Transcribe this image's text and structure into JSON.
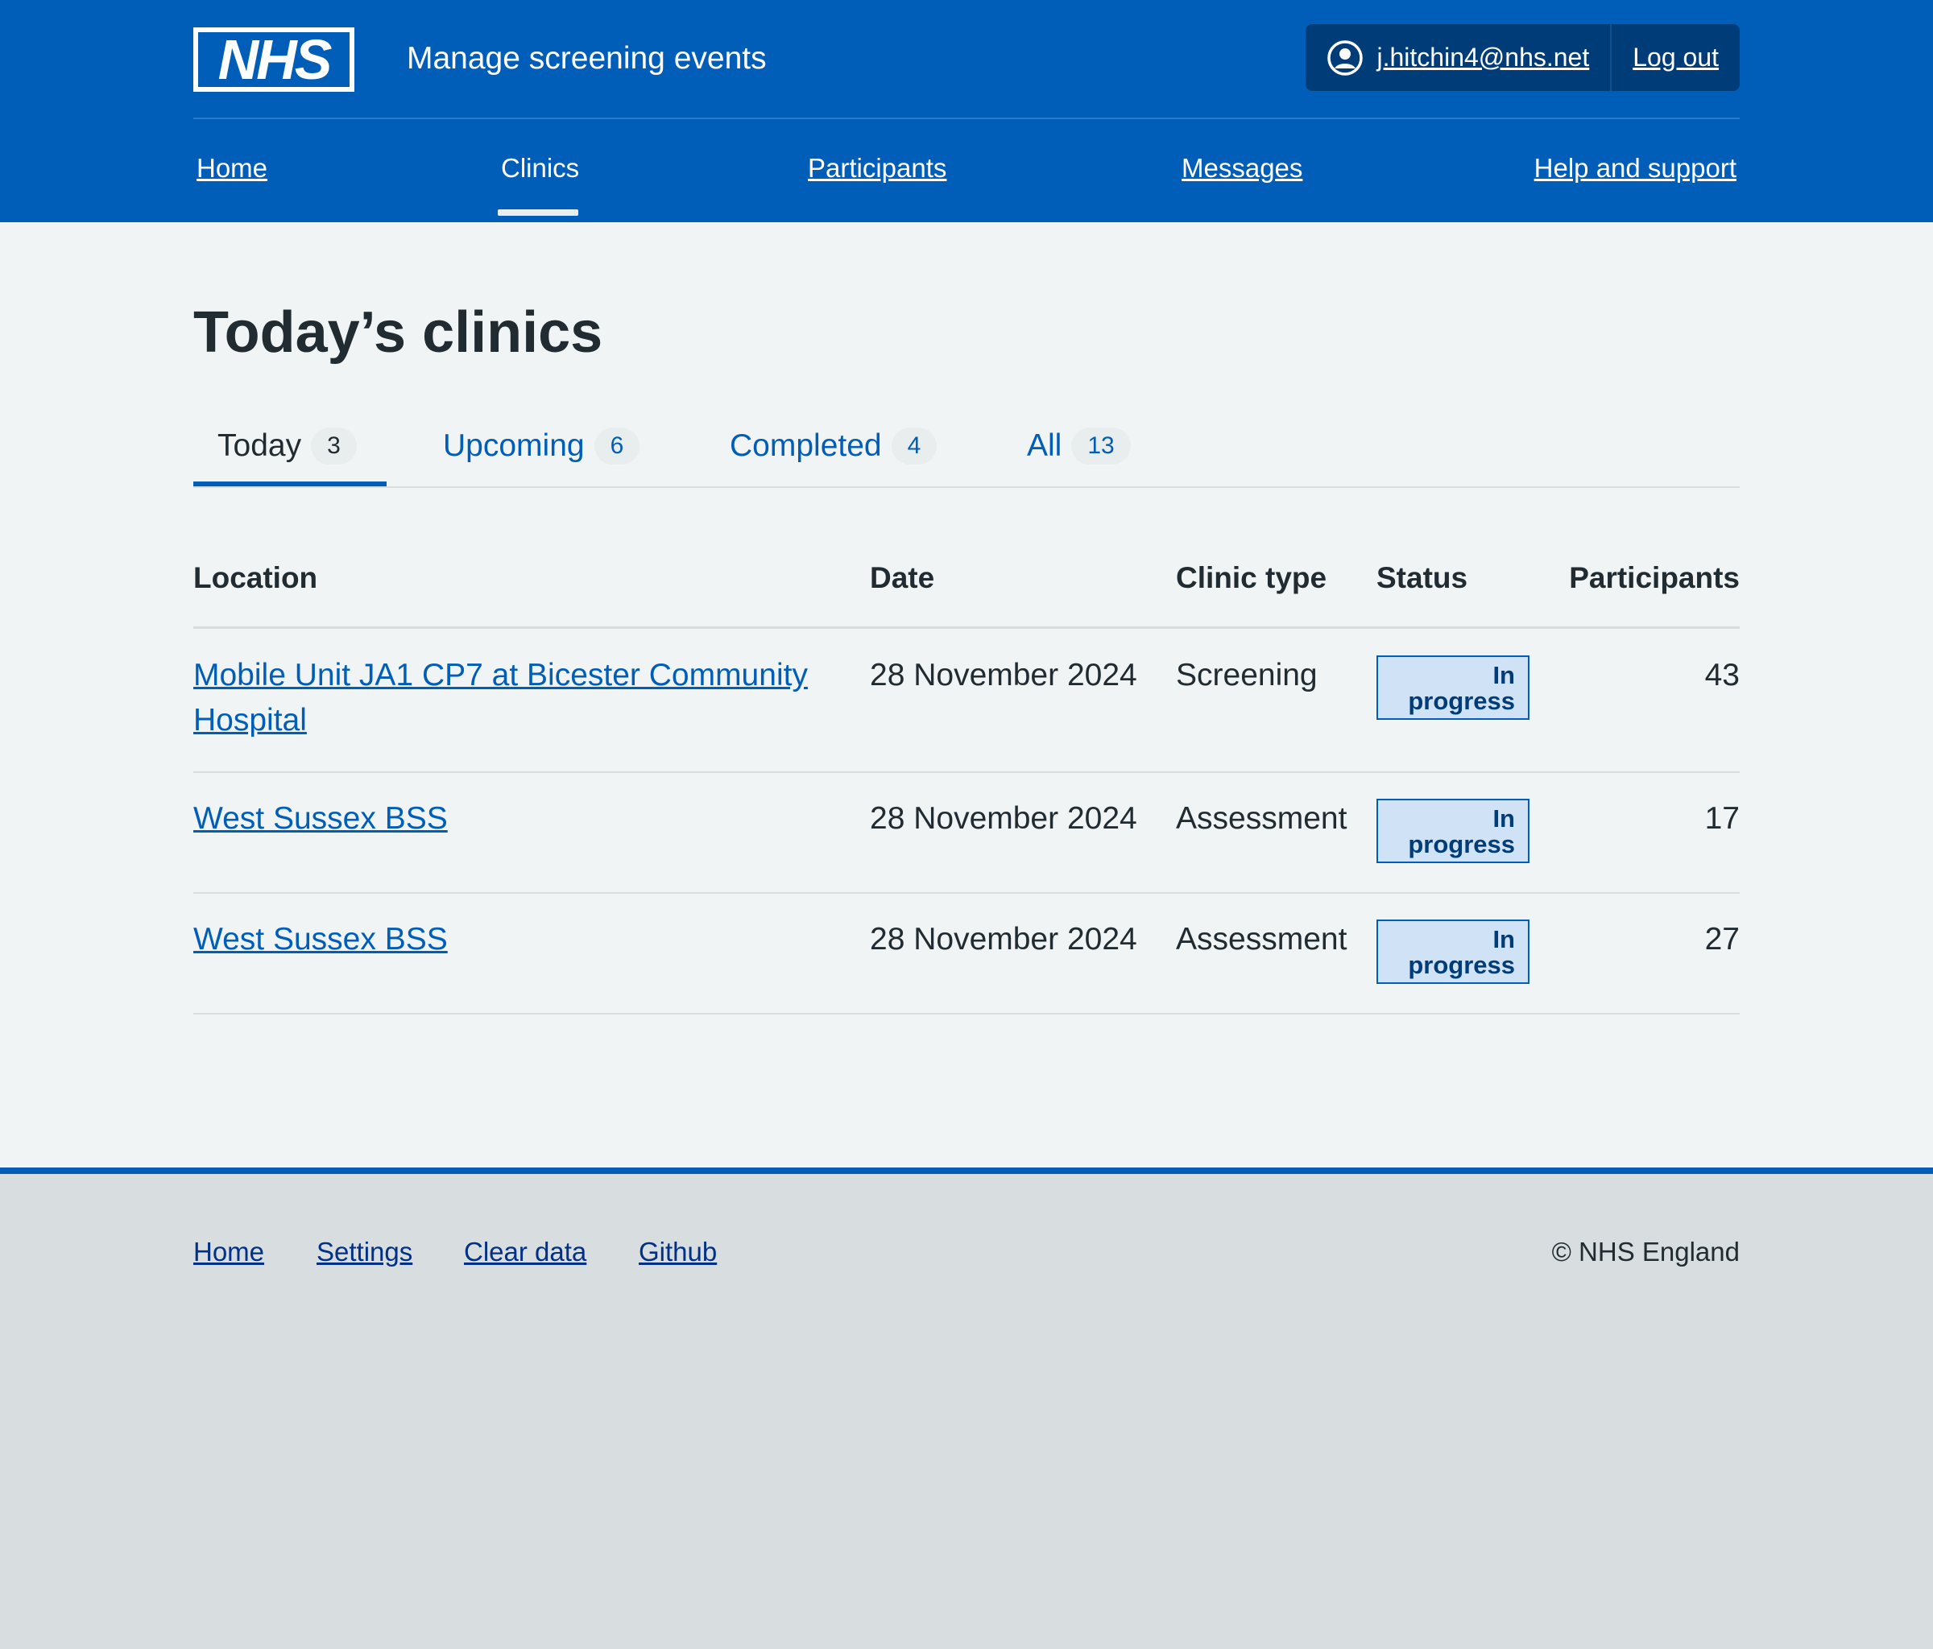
{
  "header": {
    "logo_text": "NHS",
    "service_name": "Manage screening events",
    "account": {
      "user_email": "j.hitchin4@nhs.net",
      "logout_label": "Log out"
    },
    "nav": [
      {
        "label": "Home",
        "current": false
      },
      {
        "label": "Clinics",
        "current": true
      },
      {
        "label": "Participants",
        "current": false
      },
      {
        "label": "Messages",
        "current": false
      },
      {
        "label": "Help and support",
        "current": false
      }
    ]
  },
  "main": {
    "title": "Today’s clinics",
    "tabs": [
      {
        "label": "Today",
        "count": "3",
        "current": true
      },
      {
        "label": "Upcoming",
        "count": "6",
        "current": false
      },
      {
        "label": "Completed",
        "count": "4",
        "current": false
      },
      {
        "label": "All",
        "count": "13",
        "current": false
      }
    ],
    "table": {
      "headers": [
        "Location",
        "Date",
        "Clinic type",
        "Status",
        "Participants"
      ],
      "rows": [
        {
          "location": "Mobile Unit JA1 CP7 at Bicester Community Hospital",
          "date": "28 November 2024",
          "clinic_type": "Screening",
          "status": "In progress",
          "participants": "43"
        },
        {
          "location": "West Sussex BSS",
          "date": "28 November 2024",
          "clinic_type": "Assessment",
          "status": "In progress",
          "participants": "17"
        },
        {
          "location": "West Sussex BSS",
          "date": "28 November 2024",
          "clinic_type": "Assessment",
          "status": "In progress",
          "participants": "27"
        }
      ]
    }
  },
  "footer": {
    "links": [
      "Home",
      "Settings",
      "Clear data",
      "Github"
    ],
    "copyright": "© NHS England"
  },
  "colors": {
    "nhs_blue": "#005eb8",
    "dark_blue": "#003d78",
    "page_background": "#f0f4f5",
    "footer_background": "#d8dde0",
    "tag_background": "#d0e2f5",
    "text": "#212b32"
  },
  "icons": {
    "account": "user-circle-icon",
    "logo": "nhs-logo"
  }
}
